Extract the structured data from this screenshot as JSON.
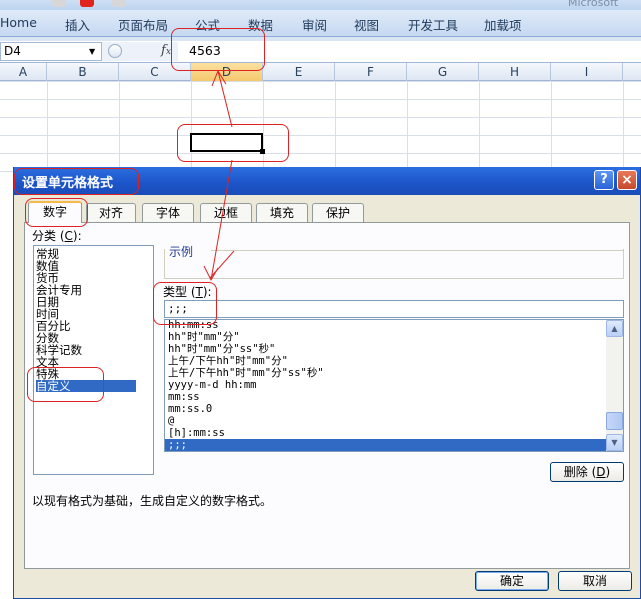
{
  "titlebar": {
    "text": "Microsoft",
    "button_colors": [
      "#d7d7d7",
      "#e0241b",
      "#d7d7d7"
    ]
  },
  "ribbon": {
    "tabs": [
      "Home",
      "插入",
      "页面布局",
      "公式",
      "数据",
      "审阅",
      "视图",
      "开发工具",
      "加载项"
    ]
  },
  "formula_bar": {
    "name_box": "D4",
    "fx_icon": "fx-icon",
    "value": "4563"
  },
  "sheet": {
    "columns": [
      "A",
      "B",
      "C",
      "D",
      "E",
      "F",
      "G",
      "H",
      "I"
    ],
    "selected_column": "D"
  },
  "dialog": {
    "title": "设置单元格格式",
    "help_label": "?",
    "close_label": "×",
    "tabs": [
      "数字",
      "对齐",
      "字体",
      "边框",
      "填充",
      "保护"
    ],
    "active_tab": "数字",
    "category_label": "分类 (",
    "category_key": "C",
    "category_label_end": "):",
    "categories": [
      "常规",
      "数值",
      "货币",
      "会计专用",
      "日期",
      "时间",
      "百分比",
      "分数",
      "科学记数",
      "文本",
      "特殊",
      "自定义"
    ],
    "selected_category": "自定义",
    "sample_label": "示例",
    "type_label": "类型 (",
    "type_key": "T",
    "type_label_end": "):",
    "type_value": ";;;",
    "formats": [
      "hh:mm:ss",
      "hh\"时\"mm\"分\"",
      "hh\"时\"mm\"分\"ss\"秒\"",
      "上午/下午hh\"时\"mm\"分\"",
      "上午/下午hh\"时\"mm\"分\"ss\"秒\"",
      "yyyy-m-d hh:mm",
      "mm:ss",
      "mm:ss.0",
      "@",
      "[h]:mm:ss",
      ";;;"
    ],
    "selected_format": ";;;",
    "delete_label": "删除 (",
    "delete_key": "D",
    "delete_label_end": ")",
    "description": "以现有格式为基础，生成自定义的数字格式。",
    "ok_label": "确定",
    "cancel_label": "取消"
  },
  "colors": {
    "annotation": "#dd2222",
    "selection": "#316ac5",
    "title_bar": "#1c54c8"
  }
}
